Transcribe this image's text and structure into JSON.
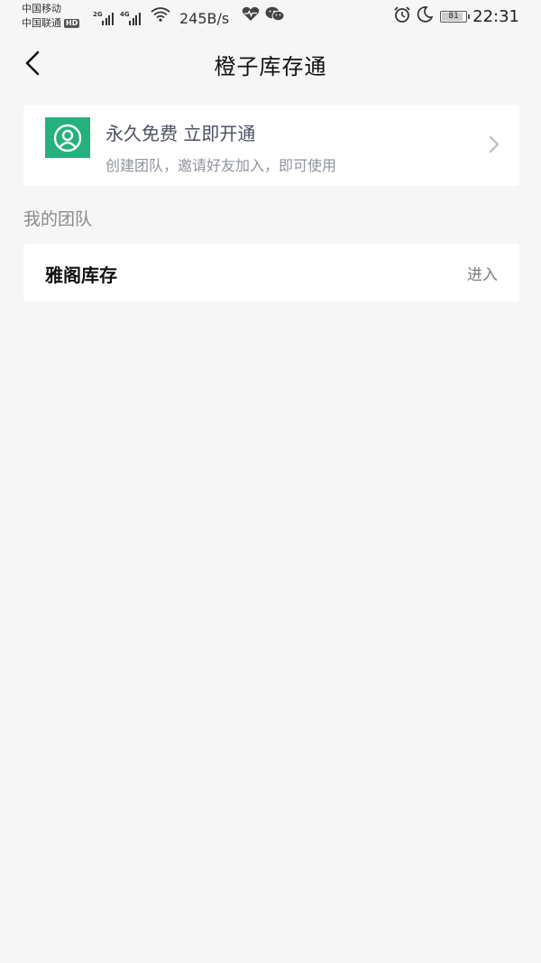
{
  "status_bar": {
    "carrier_1": "中国移动",
    "carrier_2": "中国联通",
    "hd_badge": "HD",
    "network_1": "2G",
    "network_2": "4G",
    "net_speed": "245B/s",
    "battery_level": "81",
    "time": "22:31",
    "icons": [
      "signal-icon",
      "wifi-icon",
      "heart-rate-icon",
      "wechat-icon",
      "alarm-icon",
      "moon-icon",
      "battery-icon"
    ]
  },
  "header": {
    "title": "橙子库存通",
    "back_icon": "chevron-left-icon"
  },
  "promo": {
    "title": "永久免费 立即开通",
    "subtitle": "创建团队，邀请好友加入，即可使用",
    "icon": "user-circle-icon",
    "accent_color": "#25b07d"
  },
  "teams": {
    "section_label": "我的团队",
    "items": [
      {
        "name": "雅阁库存",
        "action": "进入"
      }
    ]
  }
}
